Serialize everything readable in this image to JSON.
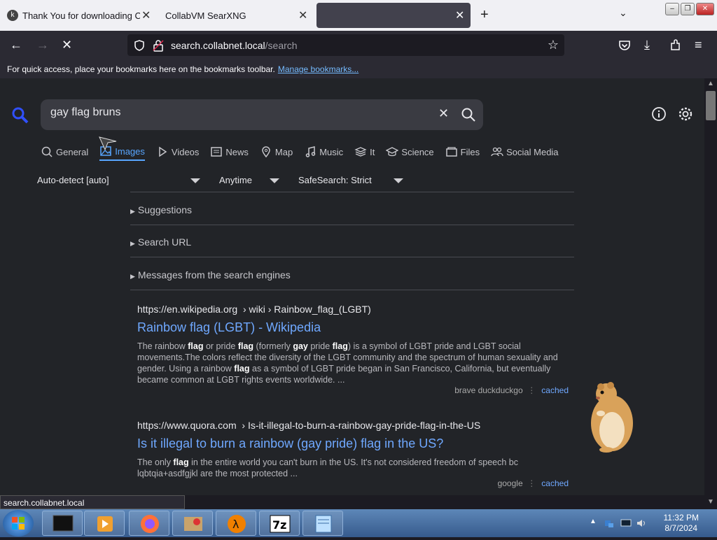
{
  "browser": {
    "tabs": [
      {
        "title": "Thank You for downloading Cc",
        "favicon": "k-logo-icon"
      },
      {
        "title": "CollabVM SearXNG",
        "favicon": ""
      },
      {
        "title": "",
        "favicon": "",
        "active": true
      }
    ],
    "url_domain": "search.collabnet.local",
    "url_path": "/search",
    "bookmarks_hint": "For quick access, place your bookmarks here on the bookmarks toolbar.",
    "bookmarks_link": "Manage bookmarks...",
    "status_url": "search.collabnet.local"
  },
  "search": {
    "query": "gay flag bruns",
    "categories": [
      "General",
      "Images",
      "Videos",
      "News",
      "Map",
      "Music",
      "It",
      "Science",
      "Files",
      "Social Media"
    ],
    "active_category": "Images",
    "filters": {
      "language": "Auto-detect [auto]",
      "time": "Anytime",
      "safesearch": "SafeSearch: Strict"
    },
    "sections": [
      "Suggestions",
      "Search URL",
      "Messages from the search engines"
    ]
  },
  "results": [
    {
      "url_host": "https://en.wikipedia.org",
      "url_path": "› wiki › Rainbow_flag_(LGBT)",
      "title": "Rainbow flag (LGBT) - Wikipedia",
      "engines": "brave  duckduckgo",
      "cached": "cached"
    },
    {
      "url_host": "https://www.quora.com",
      "url_path": "› Is-it-illegal-to-burn-a-rainbow-gay-pride-flag-in-the-US",
      "title": "Is it illegal to burn a rainbow (gay pride) flag in the US?",
      "engines": "google",
      "cached": "cached"
    }
  ],
  "taskbar": {
    "time": "11:32 PM",
    "date": "8/7/2024"
  },
  "colors": {
    "accent": "#58a6ff",
    "link": "#6fa8ff",
    "page_bg": "#222428"
  }
}
